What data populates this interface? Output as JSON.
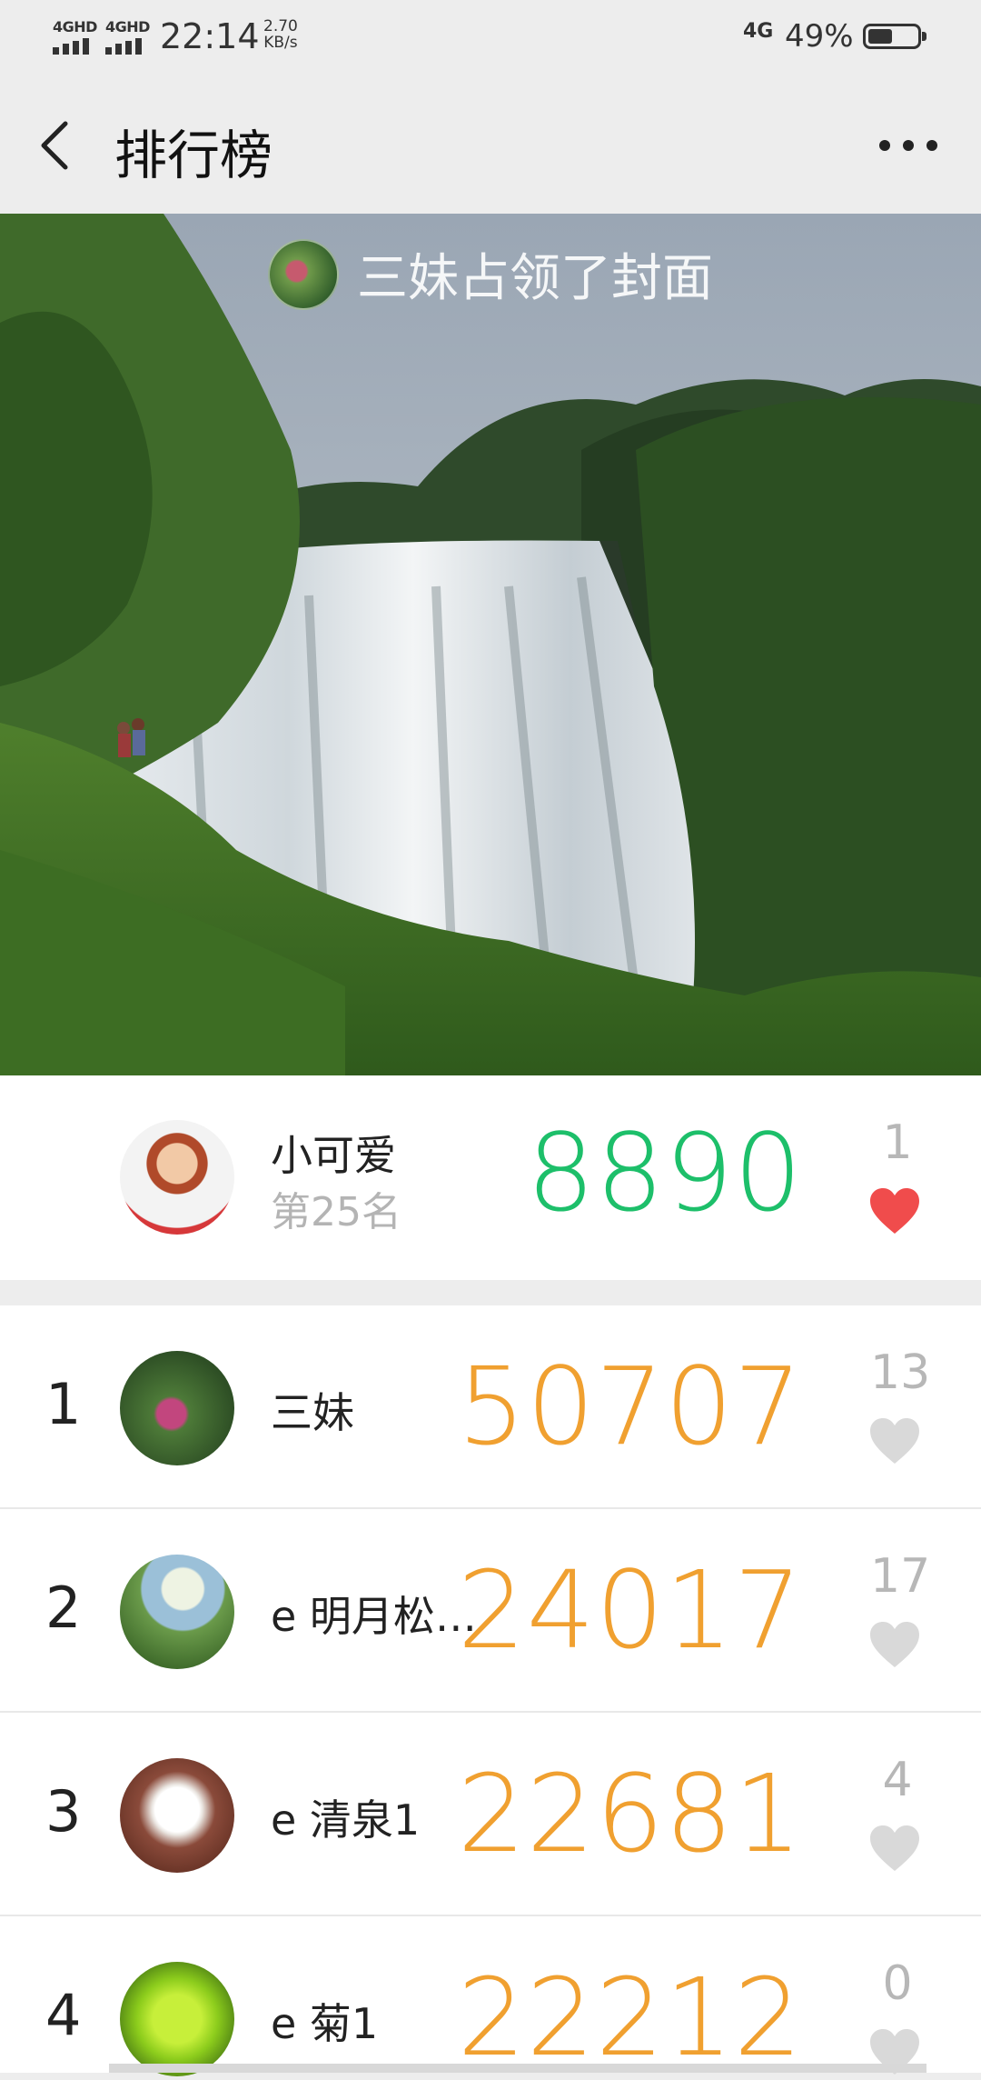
{
  "status_bar": {
    "signal1": "4GHD",
    "signal2": "4GHD",
    "time": "22:14",
    "speed_value": "2.70",
    "speed_unit": "KB/s",
    "network": "4G",
    "battery": "49%"
  },
  "header": {
    "title": "排行榜",
    "back_icon": "chevron-left-icon",
    "more_icon": "more-dots-icon"
  },
  "cover": {
    "owner_text": "三妹占领了封面"
  },
  "my_rank": {
    "name": "小可爱",
    "position_text": "第25名",
    "score": "8890",
    "likes": "1",
    "liked": true,
    "score_color": "#1dbf6a"
  },
  "leaderboard": [
    {
      "rank": "1",
      "name": "三妹",
      "score": "50707",
      "likes": "13"
    },
    {
      "rank": "2",
      "name": "e 明月松…",
      "score": "24017",
      "likes": "17"
    },
    {
      "rank": "3",
      "name": "e 清泉1",
      "score": "22681",
      "likes": "4"
    },
    {
      "rank": "4",
      "name": "e 菊1",
      "score": "22212",
      "likes": "0"
    }
  ],
  "colors": {
    "score_orange": "#f0a030",
    "heart_red": "#f04c4c",
    "heart_gray": "#d9d9d9"
  }
}
